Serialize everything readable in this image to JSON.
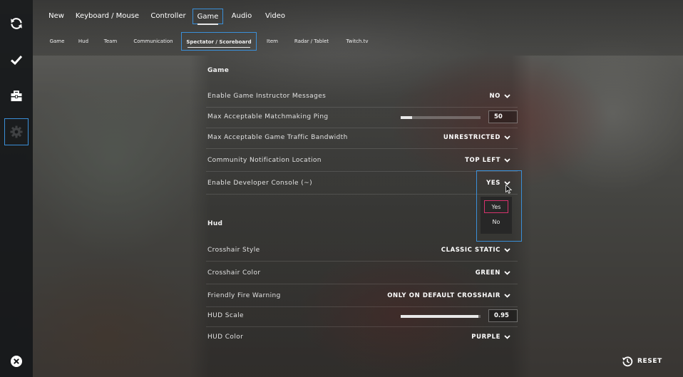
{
  "main_tabs": [
    {
      "label": "New",
      "active": false
    },
    {
      "label": "Keyboard / Mouse",
      "active": false
    },
    {
      "label": "Controller",
      "active": false
    },
    {
      "label": "Game",
      "active": true
    },
    {
      "label": "Audio",
      "active": false
    },
    {
      "label": "Video",
      "active": false
    }
  ],
  "sub_tabs": [
    {
      "label": "Game",
      "active": false
    },
    {
      "label": "Hud",
      "active": false
    },
    {
      "label": "Team",
      "active": false
    },
    {
      "label": "Communication",
      "active": false
    },
    {
      "label": "Spectator / Scoreboard",
      "active": true
    },
    {
      "label": "Item",
      "active": false
    },
    {
      "label": "Radar / Tablet",
      "active": false
    },
    {
      "label": "Twitch.tv",
      "active": false
    }
  ],
  "sidebar": {
    "items": [
      {
        "icon": "refresh-icon"
      },
      {
        "icon": "checkmark-icon"
      },
      {
        "icon": "briefcase-icon"
      },
      {
        "icon": "gear-icon",
        "active": true
      }
    ],
    "close_icon": "close-icon"
  },
  "sections": {
    "game": {
      "title": "Game",
      "rows": [
        {
          "label": "Enable Game Instructor Messages",
          "type": "dropdown",
          "value": "NO"
        },
        {
          "label": "Max Acceptable Matchmaking Ping",
          "type": "slider",
          "value": "50",
          "fraction": 0.14
        },
        {
          "label": "Max Acceptable Game Traffic Bandwidth",
          "type": "dropdown",
          "value": "UNRESTRICTED"
        },
        {
          "label": "Community Notification Location",
          "type": "dropdown",
          "value": "TOP LEFT"
        },
        {
          "label": "Enable Developer Console (~)",
          "type": "dropdown",
          "value": "YES"
        }
      ]
    },
    "hud": {
      "title": "Hud",
      "rows": [
        {
          "label": "Crosshair Style",
          "type": "dropdown",
          "value": "CLASSIC STATIC"
        },
        {
          "label": "Crosshair Color",
          "type": "dropdown",
          "value": "GREEN"
        },
        {
          "label": "Friendly Fire Warning",
          "type": "dropdown",
          "value": "ONLY ON DEFAULT CROSSHAIR"
        },
        {
          "label": "HUD Scale",
          "type": "slider",
          "value": "0.95",
          "fraction": 0.97
        },
        {
          "label": "HUD Color",
          "type": "dropdown",
          "value": "PURPLE"
        }
      ]
    }
  },
  "dev_console_dropdown": {
    "options": [
      "Yes",
      "No"
    ],
    "highlighted": "Yes"
  },
  "reset": {
    "label": "RESET",
    "icon": "history-icon"
  },
  "colors": {
    "focus_outline": "#3a8fd8",
    "option_highlight": "#d6336c",
    "sidebar_bg": "#16181a",
    "text": "#ffffff"
  }
}
